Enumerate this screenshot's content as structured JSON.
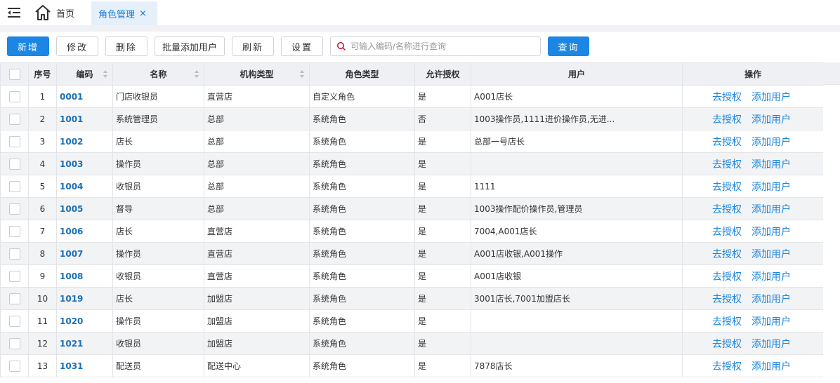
{
  "tabs": {
    "home_label": "首页",
    "active_label": "角色管理",
    "close_glyph": "×"
  },
  "toolbar": {
    "add": "新增",
    "edit": "修改",
    "delete": "删除",
    "batch_add_users": "批量添加用户",
    "refresh": "刷新",
    "settings": "设置",
    "search_placeholder": "可输入编码/名称进行查询",
    "search_value": "",
    "query": "查询"
  },
  "table": {
    "headers": {
      "index": "序号",
      "code": "编码",
      "name": "名称",
      "org_type": "机构类型",
      "role_type": "角色类型",
      "allow_grant": "允许授权",
      "users": "用户",
      "actions": "操作"
    },
    "action_grant": "去授权",
    "action_add_user": "添加用户",
    "rows": [
      {
        "index": "1",
        "code": "0001",
        "name": "门店收银员",
        "org_type": "直营店",
        "role_type": "自定义角色",
        "allow_grant": "是",
        "users": "A001店长"
      },
      {
        "index": "2",
        "code": "1001",
        "name": "系统管理员",
        "org_type": "总部",
        "role_type": "系统角色",
        "allow_grant": "否",
        "users": "1003操作员,1111进价操作员,无进..."
      },
      {
        "index": "3",
        "code": "1002",
        "name": "店长",
        "org_type": "总部",
        "role_type": "系统角色",
        "allow_grant": "是",
        "users": "总部一号店长"
      },
      {
        "index": "4",
        "code": "1003",
        "name": "操作员",
        "org_type": "总部",
        "role_type": "系统角色",
        "allow_grant": "是",
        "users": ""
      },
      {
        "index": "5",
        "code": "1004",
        "name": "收银员",
        "org_type": "总部",
        "role_type": "系统角色",
        "allow_grant": "是",
        "users": "1111"
      },
      {
        "index": "6",
        "code": "1005",
        "name": "督导",
        "org_type": "总部",
        "role_type": "系统角色",
        "allow_grant": "是",
        "users": "1003操作配价操作员,管理员"
      },
      {
        "index": "7",
        "code": "1006",
        "name": "店长",
        "org_type": "直营店",
        "role_type": "系统角色",
        "allow_grant": "是",
        "users": "7004,A001店长"
      },
      {
        "index": "8",
        "code": "1007",
        "name": "操作员",
        "org_type": "直营店",
        "role_type": "系统角色",
        "allow_grant": "是",
        "users": "A001店收银,A001操作"
      },
      {
        "index": "9",
        "code": "1008",
        "name": "收银员",
        "org_type": "直营店",
        "role_type": "系统角色",
        "allow_grant": "是",
        "users": "A001店收银"
      },
      {
        "index": "10",
        "code": "1019",
        "name": "店长",
        "org_type": "加盟店",
        "role_type": "系统角色",
        "allow_grant": "是",
        "users": "3001店长,7001加盟店长"
      },
      {
        "index": "11",
        "code": "1020",
        "name": "操作员",
        "org_type": "加盟店",
        "role_type": "系统角色",
        "allow_grant": "是",
        "users": ""
      },
      {
        "index": "12",
        "code": "1021",
        "name": "收银员",
        "org_type": "加盟店",
        "role_type": "系统角色",
        "allow_grant": "是",
        "users": ""
      },
      {
        "index": "13",
        "code": "1031",
        "name": "配送员",
        "org_type": "配送中心",
        "role_type": "系统角色",
        "allow_grant": "是",
        "users": "7878店长"
      }
    ]
  },
  "colors": {
    "accent": "#1b86e3",
    "code_text": "#1b6fb8",
    "active_tab_bg": "#e6f0fb",
    "header_bg": "#eef0f3",
    "alt_row_bg": "#f2f3f5"
  }
}
